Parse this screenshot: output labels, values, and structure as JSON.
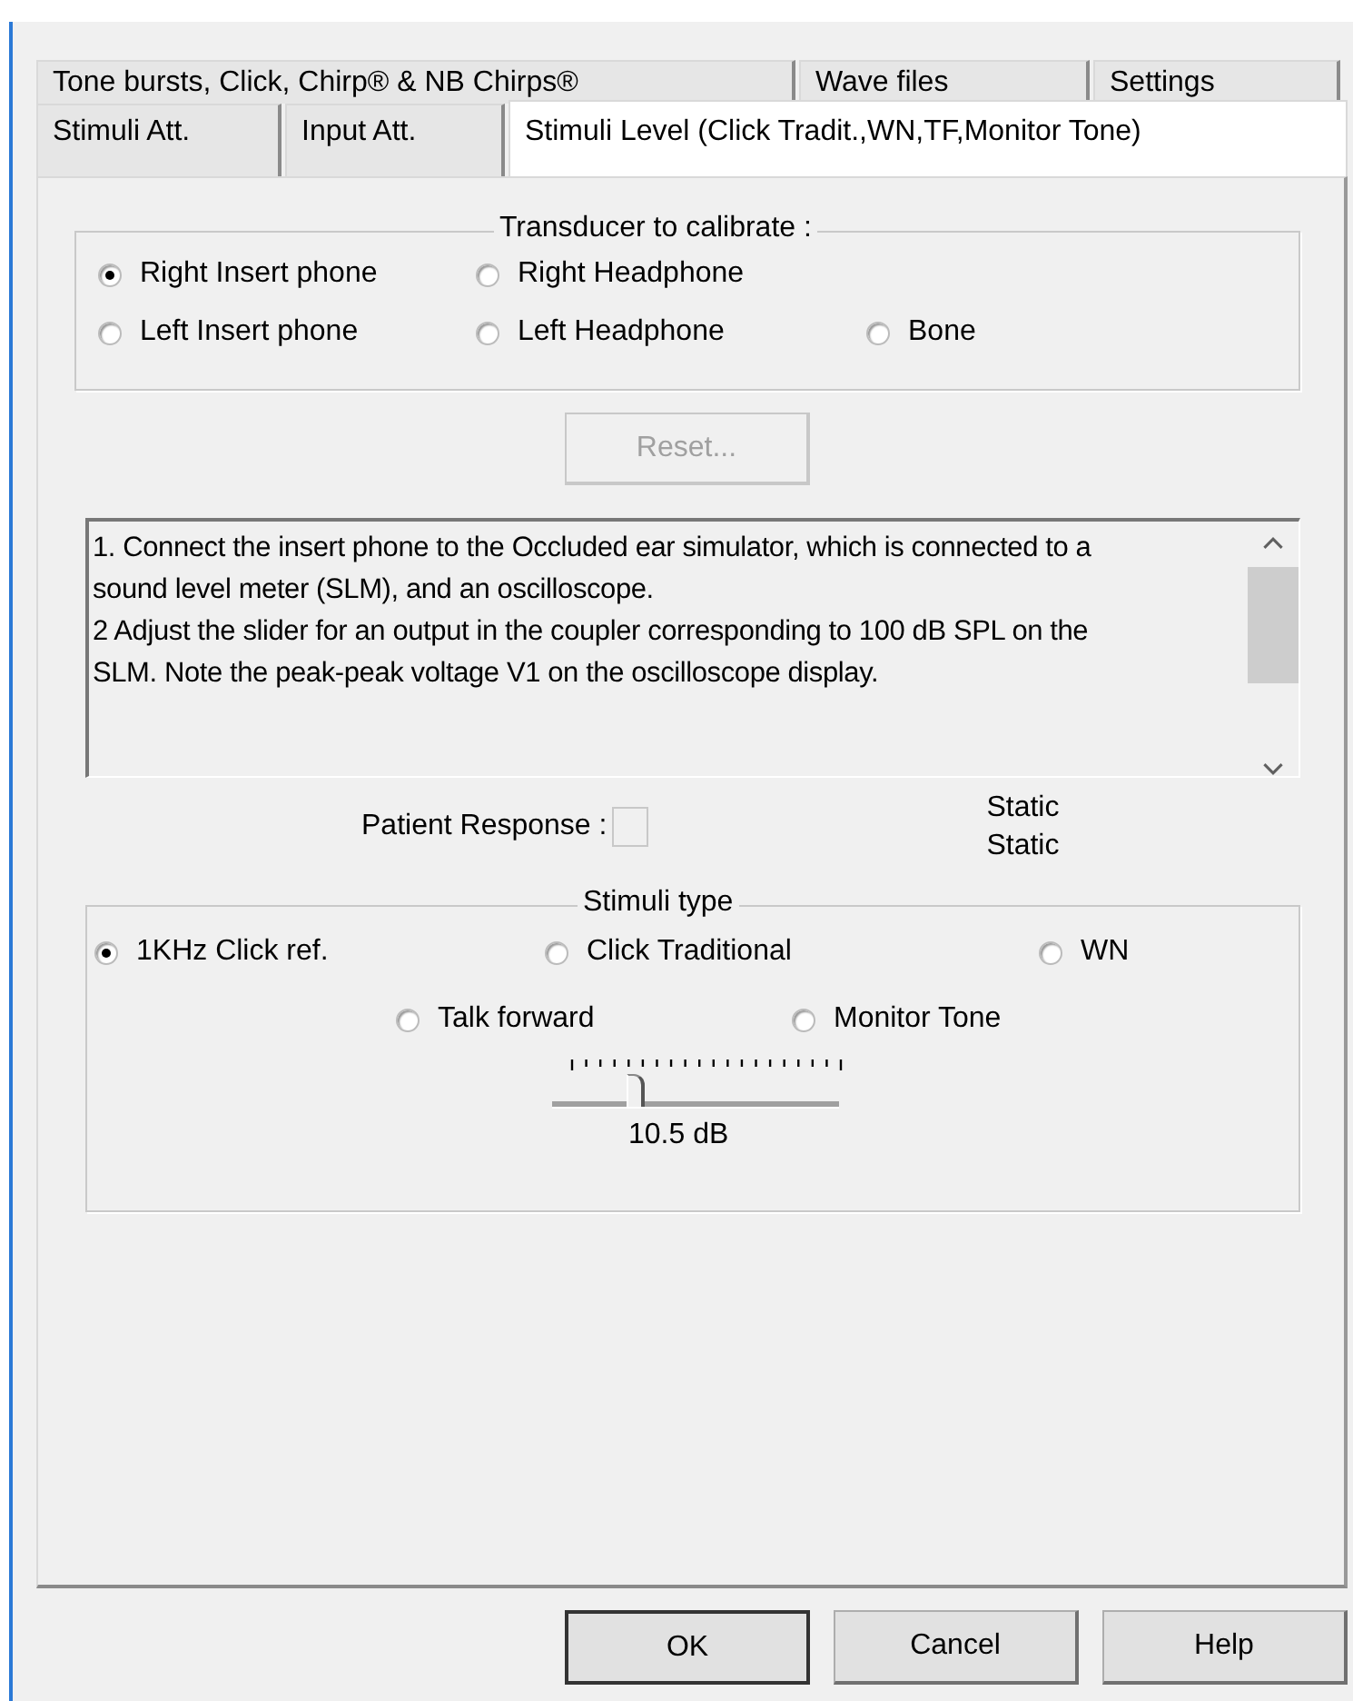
{
  "tabs": [
    [
      {
        "label": "Tone bursts, Click, Chirp® & NB Chirps®",
        "selected": false
      },
      {
        "label": "Wave files",
        "selected": false
      },
      {
        "label": "Settings",
        "selected": false
      }
    ],
    [
      {
        "label": "Stimuli Att.",
        "selected": false
      },
      {
        "label": "Input Att.",
        "selected": false
      },
      {
        "label": "Stimuli Level (Click Tradit.,WN,TF,Monitor Tone)",
        "selected": true
      }
    ]
  ],
  "transducer": {
    "title": "Transducer to calibrate :",
    "options": [
      {
        "label": "Right Insert phone",
        "selected": true
      },
      {
        "label": "Right Headphone",
        "selected": false
      },
      {
        "label": "Left Insert phone",
        "selected": false
      },
      {
        "label": "Left Headphone",
        "selected": false
      },
      {
        "label": "Bone",
        "selected": false
      }
    ]
  },
  "reset_button": {
    "label": "Reset...",
    "disabled": true
  },
  "instructions": "1. Connect the insert phone to the Occluded ear simulator, which is connected to a sound level meter (SLM), and an oscilloscope.\n2 Adjust the slider for an output in the coupler corresponding to 100 dB SPL on the SLM. Note the peak-peak voltage V1 on the oscilloscope display.",
  "patient_response": {
    "label": "Patient Response :",
    "checked": false
  },
  "static_labels": [
    "Static",
    "Static"
  ],
  "stimuli_type": {
    "title": "Stimuli type",
    "options": [
      {
        "label": "1KHz Click ref.",
        "selected": true
      },
      {
        "label": "Click Traditional",
        "selected": false
      },
      {
        "label": "WN",
        "selected": false
      },
      {
        "label": "Talk forward",
        "selected": false
      },
      {
        "label": "Monitor Tone",
        "selected": false
      }
    ]
  },
  "slider": {
    "level": 0.26,
    "reading": "10.5 dB"
  },
  "buttons": [
    "OK",
    "Cancel",
    "Help"
  ]
}
